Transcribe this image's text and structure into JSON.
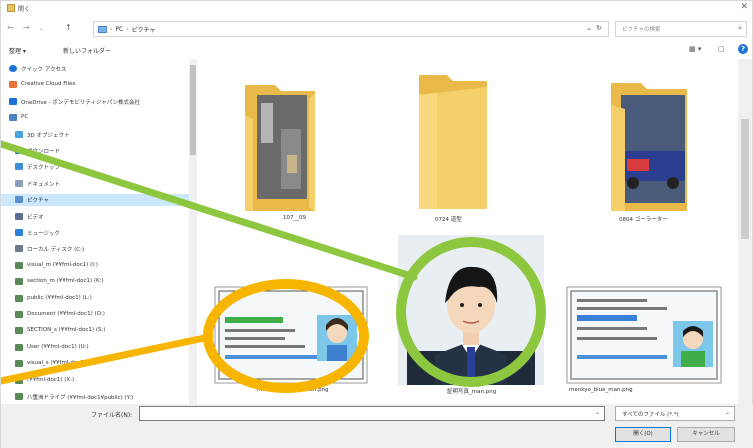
{
  "window": {
    "title": "開く",
    "close_glyph": "✕"
  },
  "nav": {
    "back_glyph": "←",
    "forward_glyph": "→",
    "up_glyph": "↑",
    "breadcrumbs": [
      "PC",
      "ピクチャ"
    ],
    "crumb_sep": "›",
    "dropdown_glyph": "⌄",
    "refresh_glyph": "↻",
    "search_placeholder": "ピクチャの検索",
    "search_glyph": "⌕"
  },
  "toolbar": {
    "organize": "整理 ▾",
    "new_folder": "新しいフォルダー",
    "view_glyph": "▦ ▾",
    "pane_glyph": "▢",
    "help_glyph": "?"
  },
  "sidebar": {
    "items": [
      {
        "label": "クイック アクセス",
        "icon": "star-icon",
        "color": "#1e73d8"
      },
      {
        "label": "Creative Cloud Files",
        "icon": "creative-cloud-icon",
        "color": "#e8733a"
      },
      {
        "label": "OneDrive - ボンデモビリティジャパン株式会社",
        "icon": "onedrive-icon",
        "color": "#1e73d8"
      },
      {
        "label": "PC",
        "icon": "pc-icon",
        "color": "#4a83c1"
      },
      {
        "label": "3D オブジェクト",
        "icon": "cube-icon",
        "color": "#4aa3e0"
      },
      {
        "label": "ダウンロード",
        "icon": "download-icon",
        "color": "#1e73d8"
      },
      {
        "label": "デスクトップ",
        "icon": "desktop-icon",
        "color": "#3d8fd9"
      },
      {
        "label": "ドキュメント",
        "icon": "document-icon",
        "color": "#8aa0b8"
      },
      {
        "label": "ピクチャ",
        "icon": "pictures-icon",
        "color": "#5a8fc9"
      },
      {
        "label": "ビデオ",
        "icon": "video-icon",
        "color": "#5a6f8f"
      },
      {
        "label": "ミュージック",
        "icon": "music-icon",
        "color": "#2a7fd6"
      },
      {
        "label": "ローカル ディスク (C:)",
        "icon": "disk-icon",
        "color": "#6a7a8a"
      },
      {
        "label": "visual_m (¥¥fml-doc1) (I:)",
        "icon": "network-drive-icon",
        "color": "#5a8a5a"
      },
      {
        "label": "section_m (¥¥fml-doc1) (K:)",
        "icon": "network-drive-icon",
        "color": "#5a8a5a"
      },
      {
        "label": "public (¥¥fml-doc1) (L:)",
        "icon": "network-drive-icon",
        "color": "#5a8a5a"
      },
      {
        "label": "Document (¥¥fml-doc1) (O:)",
        "icon": "network-drive-icon",
        "color": "#5a8a5a"
      },
      {
        "label": "SECTION_s (¥¥fml-doc1) (S:)",
        "icon": "network-drive-icon",
        "color": "#5a8a5a"
      },
      {
        "label": "User (¥¥fml-doc1) (U:)",
        "icon": "network-drive-icon",
        "color": "#5a8a5a"
      },
      {
        "label": "visual_s (¥¥fml-doc1) (V:)",
        "icon": "network-drive-icon",
        "color": "#5a8a5a"
      },
      {
        "label": "(¥¥fml-doc1) (X:)",
        "icon": "network-drive-icon",
        "color": "#5a8a5a"
      },
      {
        "label": "八重洲ドライブ (¥¥fml-doc1¥public) (Y:)",
        "icon": "network-drive-icon",
        "color": "#5a8a5a"
      }
    ],
    "selected_index": 8
  },
  "files": [
    {
      "name": "107__09",
      "kind": "folder-photo"
    },
    {
      "name": "0724 道型",
      "kind": "folder-empty"
    },
    {
      "name": "0804 ゴーラーター",
      "kind": "folder-car"
    },
    {
      "name": "menkyo_blue_women.png",
      "kind": "license-woman"
    },
    {
      "name": "証明写真_man.png",
      "kind": "id-photo-man"
    },
    {
      "name": "menkyo_blue_man.png",
      "kind": "license-man"
    }
  ],
  "bottom": {
    "filename_label": "ファイル名(N):",
    "filename_value": "",
    "filetype": "すべてのファイル (*.*)",
    "open_button": "開く(O)",
    "cancel_button": "キャンセル",
    "dropdown_glyph": "⌄"
  },
  "annotations": {
    "green": "#8dc63f",
    "orange": "#f7b500",
    "folder_color": "#f5cf6a"
  }
}
